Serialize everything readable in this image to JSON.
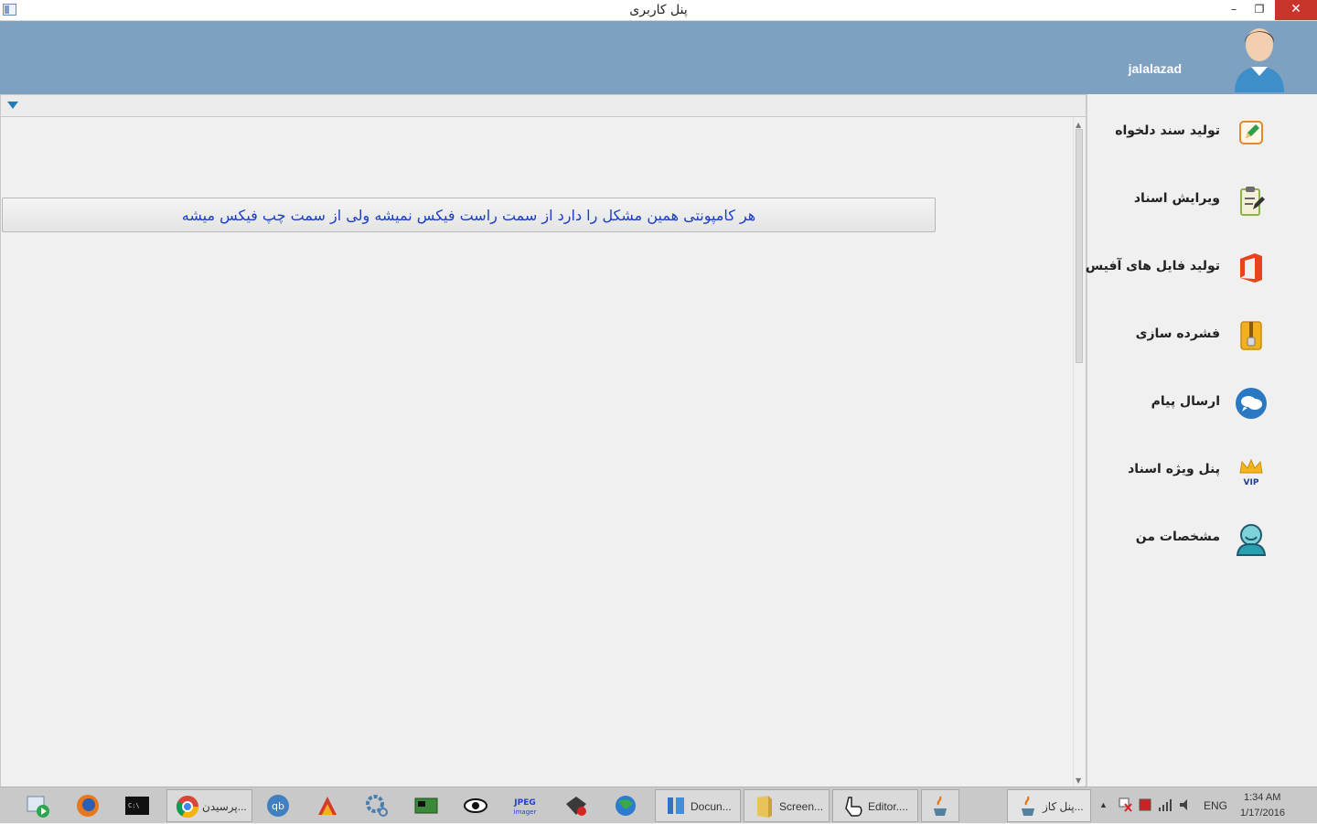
{
  "window": {
    "title": "پنل کاربری",
    "minimize": "–",
    "maximize": "❐",
    "close": "✕"
  },
  "header": {
    "username": "jalalazad"
  },
  "content": {
    "message": "هر کامپونتی همین مشکل را دارد از سمت راست فیکس نمیشه ولی از سمت چپ فیکس میشه"
  },
  "sidebar": {
    "items": [
      {
        "label": "تولید سند دلخواه",
        "icon": "edit-document-icon"
      },
      {
        "label": "ویرایش اسناد",
        "icon": "clipboard-edit-icon"
      },
      {
        "label": "تولید فایل های آفیس",
        "icon": "office-icon"
      },
      {
        "label": "فشرده سازی",
        "icon": "zip-archive-icon"
      },
      {
        "label": "ارسال پیام",
        "icon": "chat-message-icon"
      },
      {
        "label": "پنل ویژه اسناد",
        "icon": "vip-crown-icon"
      },
      {
        "label": "مشخصات من",
        "icon": "user-profile-icon"
      }
    ]
  },
  "taskbar": {
    "buttons": [
      {
        "caption": "پرسیدن..."
      },
      {
        "caption": "Docun..."
      },
      {
        "caption": "Screen..."
      },
      {
        "caption": "Editor...."
      },
      {
        "caption": ""
      },
      {
        "caption": "پنل کاز..."
      }
    ],
    "tray": {
      "language": "ENG",
      "time": "1:34 AM",
      "date": "1/17/2016"
    }
  },
  "colors": {
    "header_bg": "#7fa1c1",
    "message_text": "#1a3fc4",
    "close_button": "#c7352a",
    "panel_bg": "#f0f0f0"
  }
}
